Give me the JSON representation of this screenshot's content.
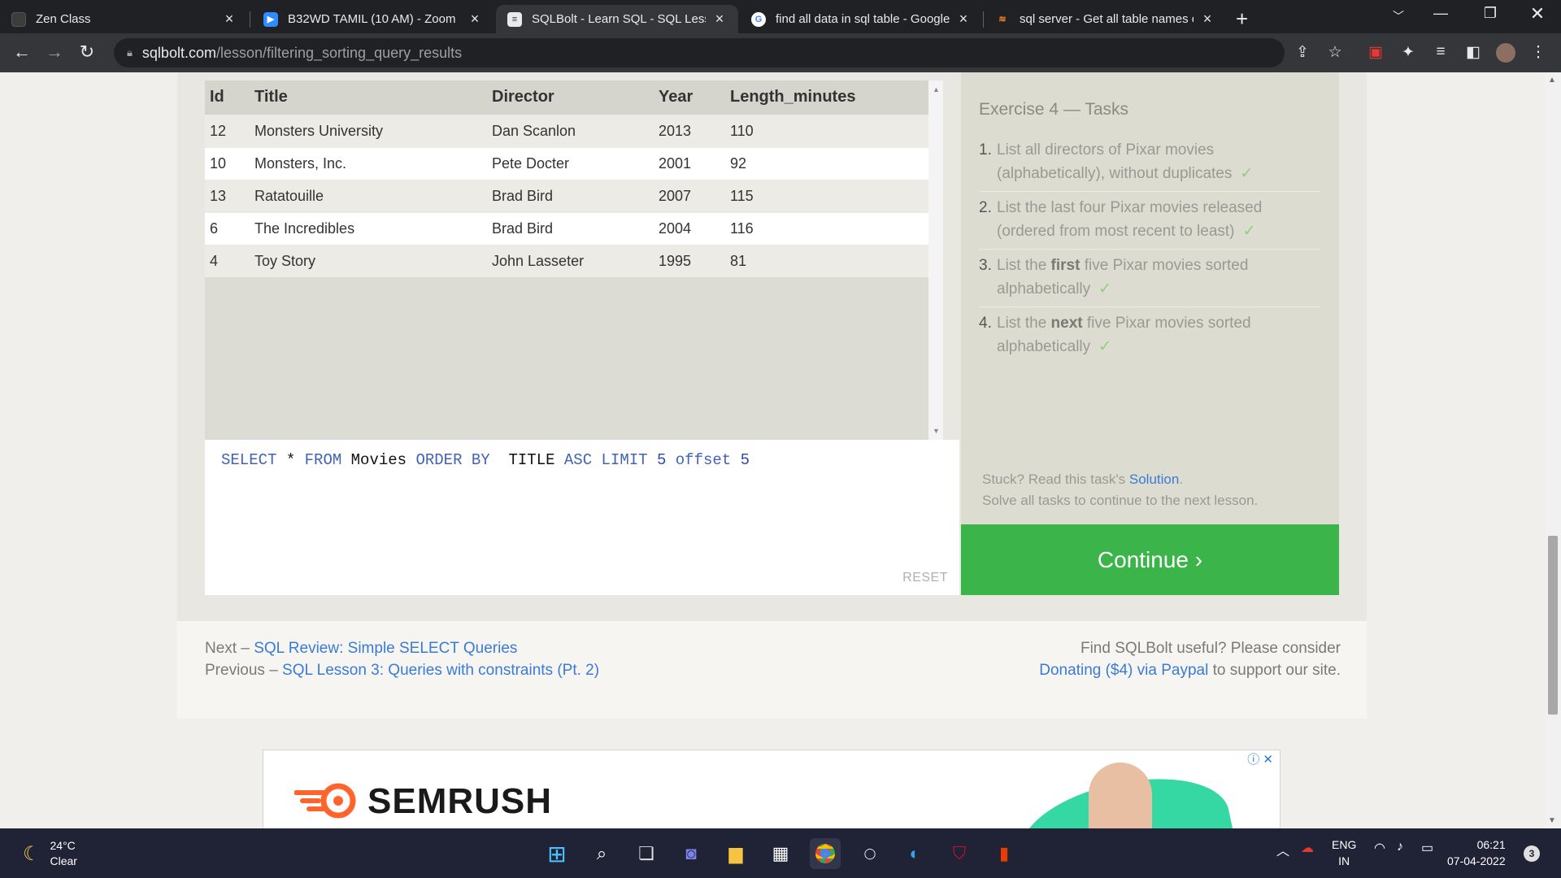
{
  "browser": {
    "tabs": [
      {
        "title": "Zen Class",
        "icon": "zen-class-favicon"
      },
      {
        "title": "B32WD TAMIL (10 AM) - Zoom",
        "icon": "zoom-favicon"
      },
      {
        "title": "SQLBolt - Learn SQL - SQL Lesson",
        "icon": "sqlbolt-favicon"
      },
      {
        "title": "find all data in sql table - Google",
        "icon": "google-favicon"
      },
      {
        "title": "sql server - Get all table names o",
        "icon": "stackoverflow-favicon"
      }
    ],
    "url_host": "sqlbolt.com",
    "url_path": "/lesson/filtering_sorting_query_results"
  },
  "results": {
    "columns": [
      "Id",
      "Title",
      "Director",
      "Year",
      "Length_minutes"
    ],
    "rows": [
      [
        "12",
        "Monsters University",
        "Dan Scanlon",
        "2013",
        "110"
      ],
      [
        "10",
        "Monsters, Inc.",
        "Pete Docter",
        "2001",
        "92"
      ],
      [
        "13",
        "Ratatouille",
        "Brad Bird",
        "2007",
        "115"
      ],
      [
        "6",
        "The Incredibles",
        "Brad Bird",
        "2004",
        "116"
      ],
      [
        "4",
        "Toy Story",
        "John Lasseter",
        "1995",
        "81"
      ]
    ]
  },
  "editor": {
    "query_tokens": [
      {
        "t": "SELECT",
        "c": "kw"
      },
      {
        "t": " * ",
        "c": "id"
      },
      {
        "t": "FROM",
        "c": "kw"
      },
      {
        "t": " Movies ",
        "c": "id"
      },
      {
        "t": "ORDER BY",
        "c": "kw"
      },
      {
        "t": "  TITLE ",
        "c": "id"
      },
      {
        "t": "ASC",
        "c": "kw"
      },
      {
        "t": " ",
        "c": "id"
      },
      {
        "t": "LIMIT",
        "c": "kw"
      },
      {
        "t": " ",
        "c": "id"
      },
      {
        "t": "5",
        "c": "num"
      },
      {
        "t": " ",
        "c": "id"
      },
      {
        "t": "offset",
        "c": "kw"
      },
      {
        "t": " ",
        "c": "id"
      },
      {
        "t": "5",
        "c": "num"
      }
    ],
    "reset_label": "RESET"
  },
  "tasks": {
    "heading": "Exercise 4 — Tasks",
    "items": [
      {
        "num": "1.",
        "pre": "List all directors of Pixar movies (alphabetically), without duplicates",
        "bold": "",
        "post": "",
        "check": "✓"
      },
      {
        "num": "2.",
        "pre": "List the last four Pixar movies released (ordered from most recent to least)",
        "bold": "",
        "post": "",
        "check": "✓"
      },
      {
        "num": "3.",
        "pre": "List the ",
        "bold": "first",
        "post": " five Pixar movies sorted alphabetically",
        "check": "✓"
      },
      {
        "num": "4.",
        "pre": "List the ",
        "bold": "next",
        "post": " five Pixar movies sorted alphabetically",
        "check": "✓"
      }
    ],
    "stuck_text": "Stuck? Read this task's ",
    "solution_link": "Solution",
    "stuck_end": ".",
    "solve_text": "Solve all tasks to continue to the next lesson.",
    "continue_label": "Continue ›"
  },
  "footer": {
    "next_prefix": "Next – ",
    "next_link": "SQL Review: Simple SELECT Queries",
    "prev_prefix": "Previous – ",
    "prev_link": "SQL Lesson 3: Queries with constraints (Pt. 2)",
    "useful_text": "Find SQLBolt useful? Please consider",
    "donate_link": "Donating ($4) via Paypal",
    "donate_suffix": " to support our site."
  },
  "ad": {
    "brand": "SEMRUSH",
    "info_icon": "ⓘ",
    "close_icon": "✕"
  },
  "taskbar": {
    "temperature": "24°C",
    "condition": "Clear",
    "lang_top": "ENG",
    "lang_bottom": "IN",
    "time": "06:21",
    "date": "07-04-2022",
    "notifications": "3"
  },
  "colors": {
    "continue": "#3bb54a",
    "link": "#3a7bd5",
    "keyword": "#4162b7"
  }
}
